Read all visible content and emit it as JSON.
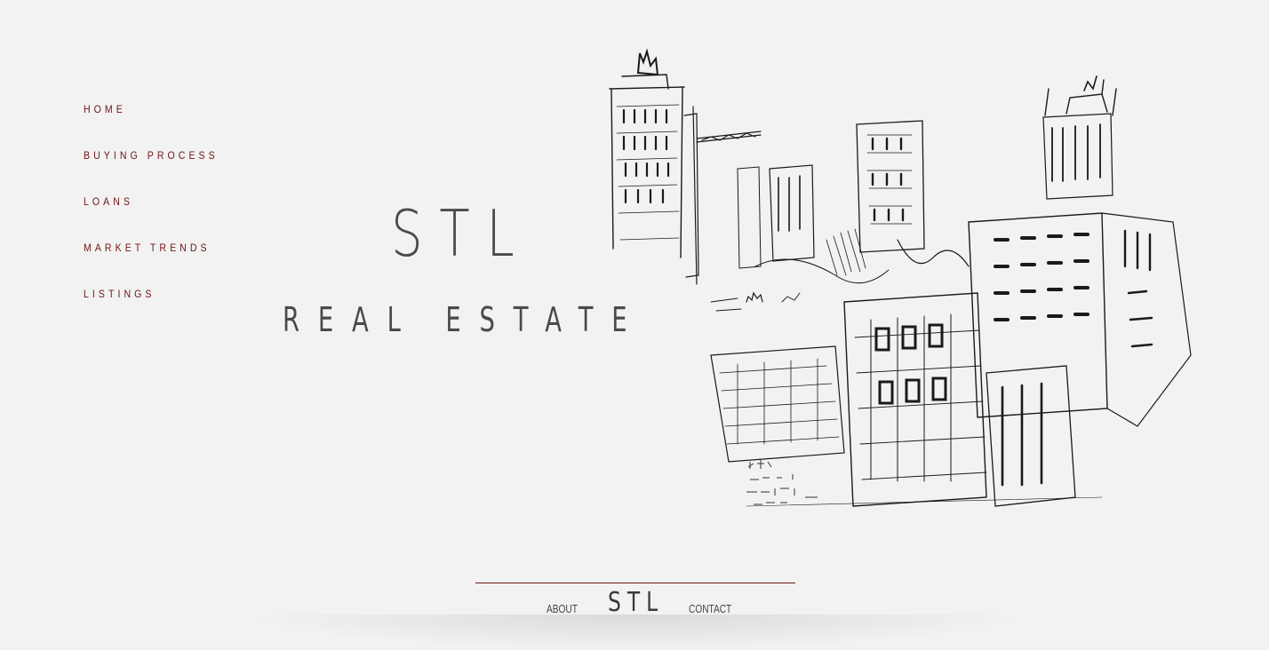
{
  "nav": {
    "items": [
      {
        "label": "HOME"
      },
      {
        "label": "BUYING PROCESS"
      },
      {
        "label": "LOANS"
      },
      {
        "label": "MARKET TRENDS"
      },
      {
        "label": "LISTINGS"
      }
    ]
  },
  "hero": {
    "logo_main": "STL",
    "logo_sub": "REAL ESTATE",
    "illustration": "city-skyline-ink-sketch"
  },
  "footer": {
    "about_label": "ABOUT",
    "logo": "STL",
    "contact_label": "CONTACT"
  },
  "colors": {
    "background": "#f2f2f2",
    "accent": "#6e1414",
    "text": "#4a4a4a"
  }
}
